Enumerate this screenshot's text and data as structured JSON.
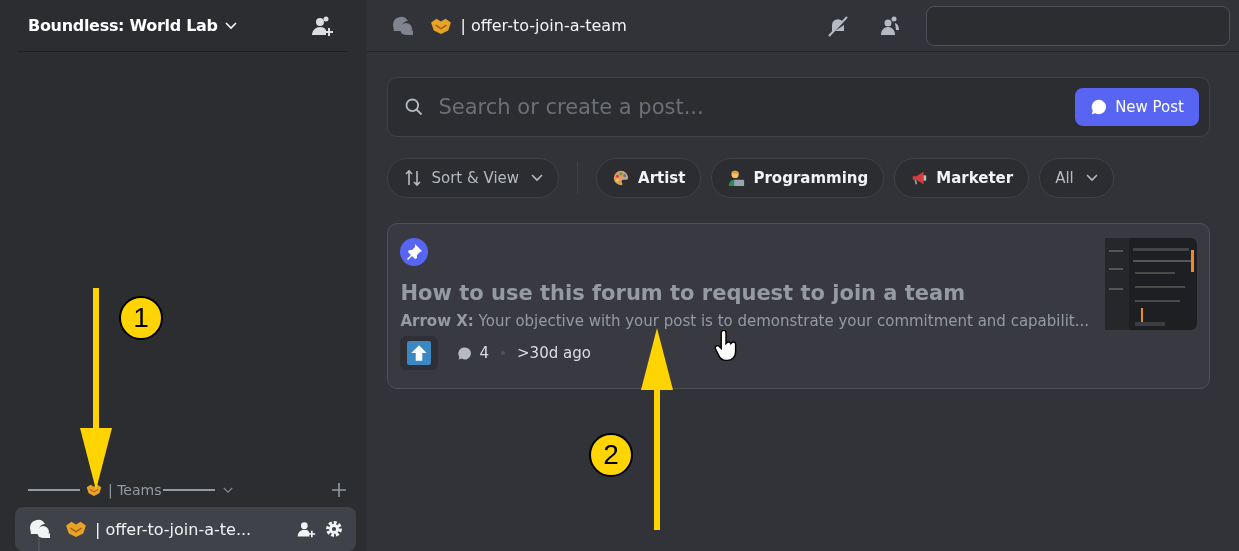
{
  "server": {
    "name": "Boundless: World Lab"
  },
  "channel_header": {
    "name": "| offer-to-join-a-team"
  },
  "sidebar": {
    "category": {
      "label": "| Teams",
      "expanded": true
    },
    "channels": [
      {
        "name": "| offer-to-join-a-te...",
        "selected": true
      }
    ]
  },
  "forum": {
    "search": {
      "placeholder": "Search or create a post..."
    },
    "new_post_button": "New Post",
    "sort_button": "Sort & View",
    "tags": [
      {
        "label": "Artist",
        "kind": "palette"
      },
      {
        "label": "Programming",
        "kind": "coder"
      },
      {
        "label": "Marketer",
        "kind": "megaphone"
      }
    ],
    "all_filter": "All",
    "posts": [
      {
        "pinned": true,
        "title": "How to use this forum to request to join a team",
        "author": "Arrow X:",
        "snippet": "Your objective with your post is to demonstrate your commitment and capabilit...",
        "comments": "4",
        "age": ">30d ago"
      }
    ]
  },
  "annotations": [
    {
      "number": "1",
      "kind": "down"
    },
    {
      "number": "2",
      "kind": "up"
    }
  ]
}
